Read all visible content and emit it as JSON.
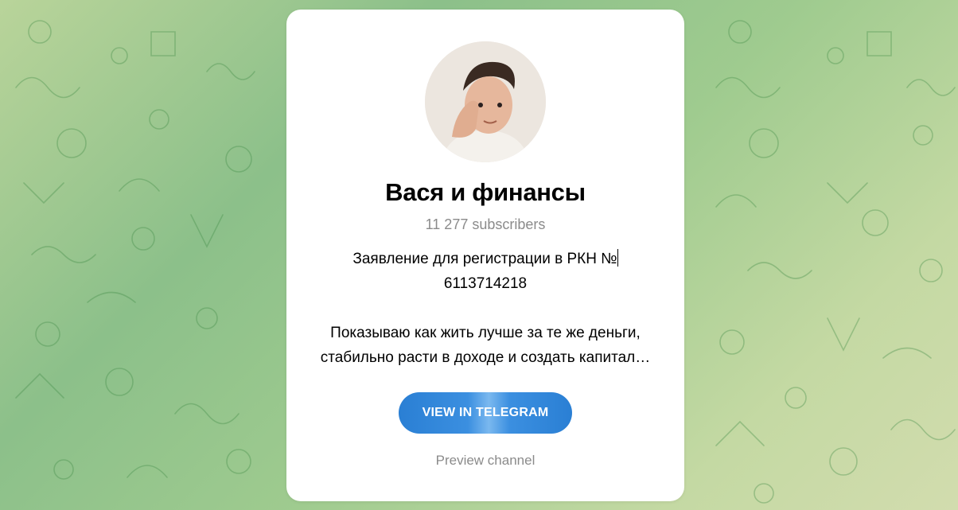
{
  "channel": {
    "title": "Вася и финансы",
    "subscribers": "11 277 subscribers",
    "description_line1": "Заявление для регистрации в РКН №",
    "description_line2": "6113714218",
    "description_line3": "Показываю как жить лучше за те же деньги,",
    "description_line4": "стабильно расти в доходе и создать капитал…"
  },
  "actions": {
    "view_label": "VIEW IN TELEGRAM",
    "preview_label": "Preview channel"
  },
  "icons": {
    "avatar": "channel-avatar-photo",
    "background": "telegram-doodle-pattern"
  },
  "colors": {
    "button": "#2a7fd4",
    "muted_text": "#8b8b8b"
  }
}
